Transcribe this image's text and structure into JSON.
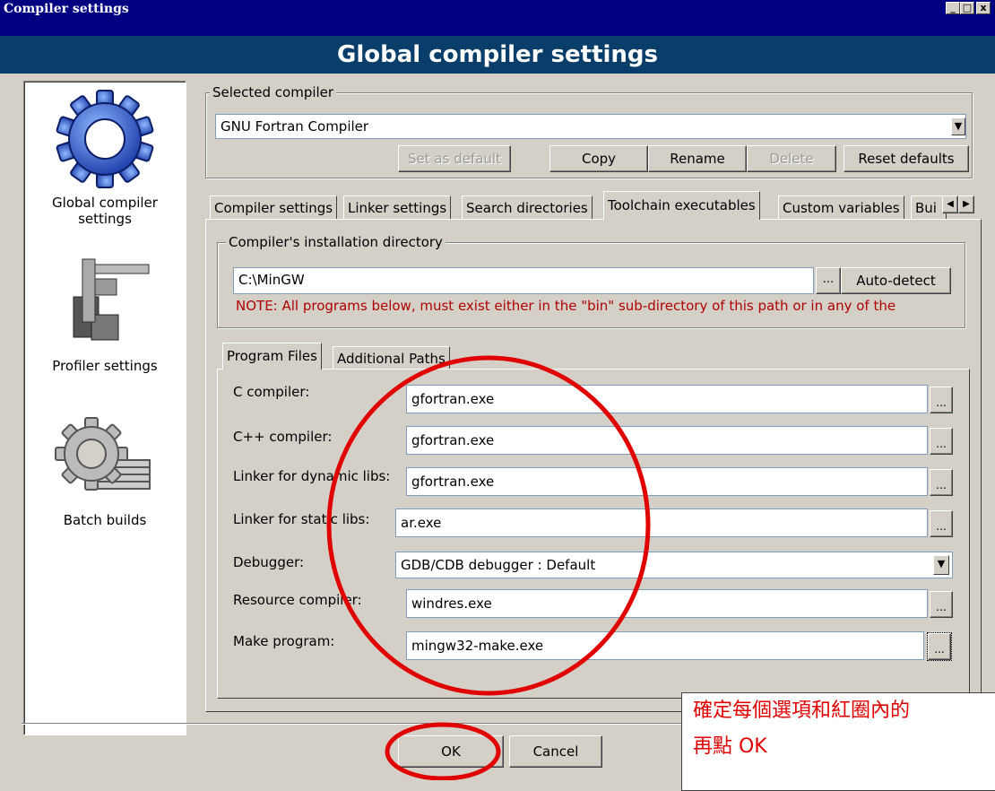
{
  "window": {
    "title": "Compiler settings",
    "header": "Global compiler settings",
    "controls": [
      "_",
      "□",
      "x"
    ]
  },
  "sidebar": {
    "items": [
      {
        "label": "Global compiler settings",
        "icon": "gear-icon"
      },
      {
        "label": "Profiler settings",
        "icon": "caliper-icon"
      },
      {
        "label": "Batch builds",
        "icon": "gear-stack-icon"
      }
    ]
  },
  "selected_compiler": {
    "group_label": "Selected compiler",
    "value": "GNU Fortran Compiler",
    "buttons": {
      "set_default": "Set as default",
      "copy": "Copy",
      "rename": "Rename",
      "delete": "Delete",
      "reset": "Reset defaults"
    }
  },
  "tabs": [
    "Compiler settings",
    "Linker settings",
    "Search directories",
    "Toolchain executables",
    "Custom variables",
    "Bui"
  ],
  "active_tab": "Toolchain executables",
  "install_dir": {
    "group_label": "Compiler's installation directory",
    "value": "C:\\MinGW",
    "browse": "...",
    "autodetect": "Auto-detect",
    "note": "NOTE: All programs below, must exist either in the \"bin\" sub-directory of this path or in any of the"
  },
  "subtabs": [
    "Program Files",
    "Additional Paths"
  ],
  "programs": [
    {
      "label": "C compiler:",
      "value": "gfortran.exe"
    },
    {
      "label": "C++ compiler:",
      "value": "gfortran.exe"
    },
    {
      "label": "Linker for dynamic libs:",
      "value": "gfortran.exe"
    },
    {
      "label": "Linker for static libs:",
      "value": "ar.exe"
    },
    {
      "label": "Debugger:",
      "value": "GDB/CDB debugger : Default"
    },
    {
      "label": "Resource compiler:",
      "value": "windres.exe"
    },
    {
      "label": "Make program:",
      "value": "mingw32-make.exe"
    }
  ],
  "browse_label": "...",
  "footer": {
    "ok": "OK",
    "cancel": "Cancel"
  },
  "annotation": {
    "line1": "確定每個選項和紅圈內的",
    "line2": "再點 OK"
  },
  "colors": {
    "title_bar": "#000080",
    "header": "#0a3e6a",
    "annotation_red": "#e00000"
  }
}
